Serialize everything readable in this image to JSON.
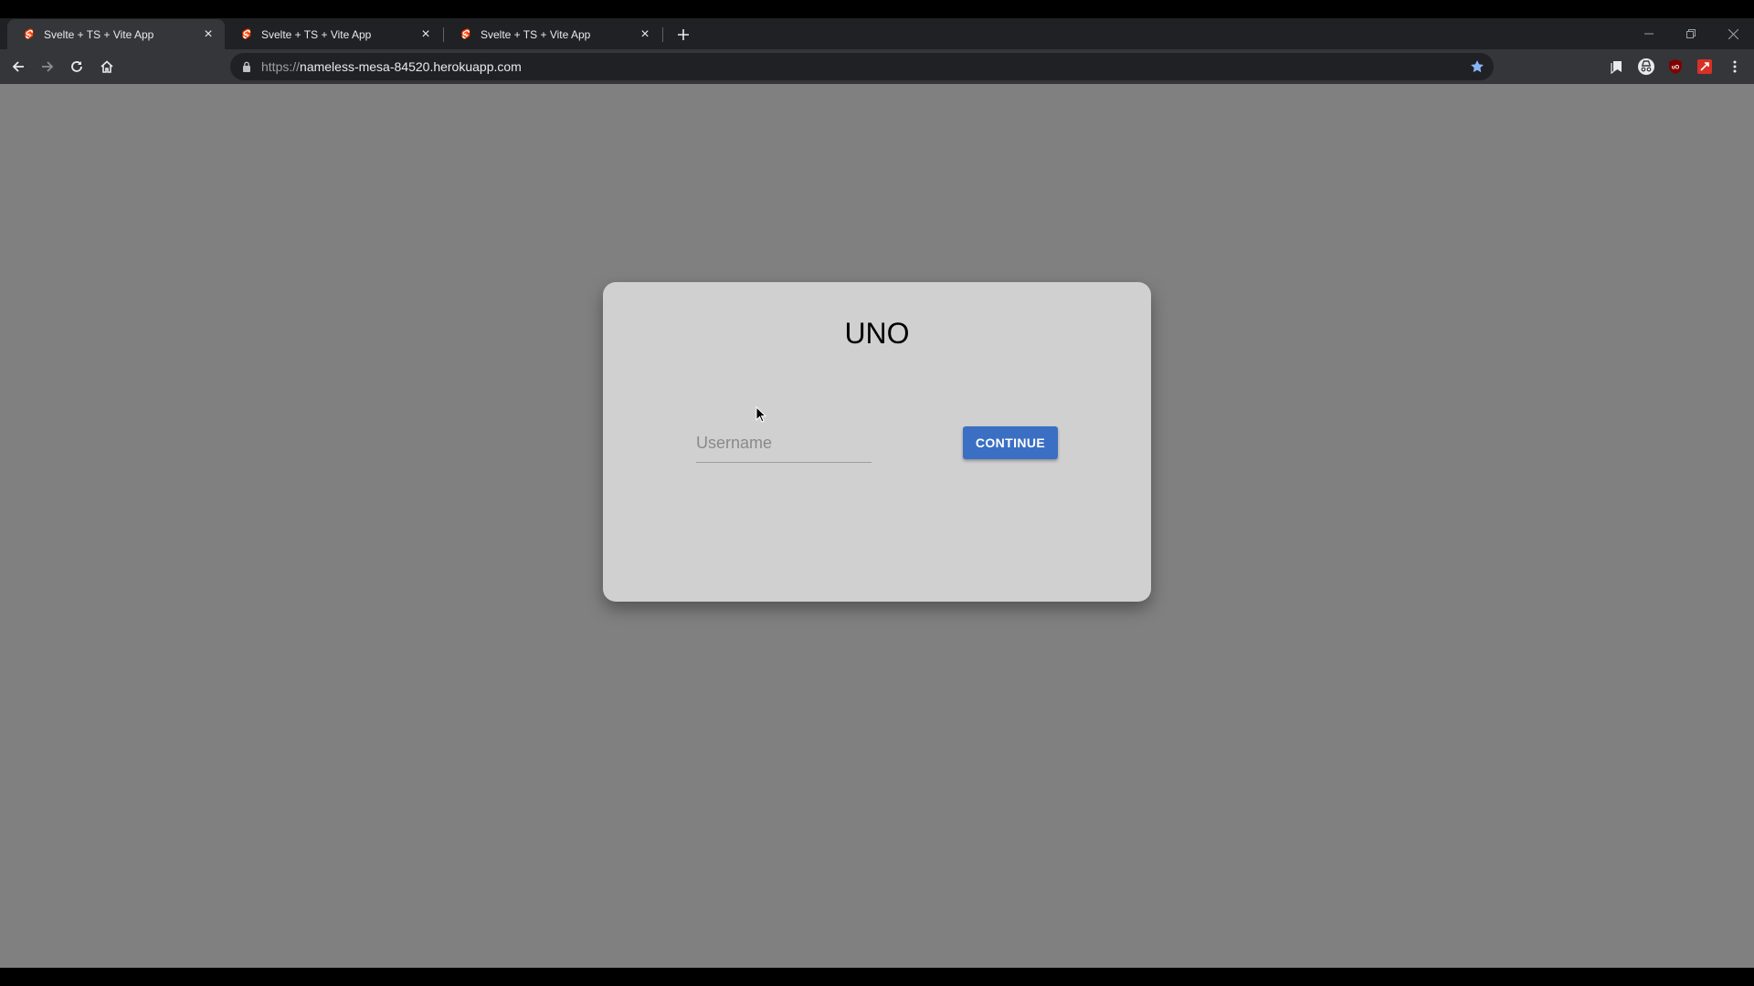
{
  "browser": {
    "tabs": [
      {
        "title": "Svelte + TS + Vite App",
        "active": true
      },
      {
        "title": "Svelte + TS + Vite App",
        "active": false
      },
      {
        "title": "Svelte + TS + Vite App",
        "active": false
      }
    ],
    "url_scheme": "https://",
    "url_host": "nameless-mesa-84520.herokuapp.com",
    "icons": {
      "favicon": "svelte-logo-icon",
      "new_tab": "plus-icon",
      "back": "arrow-left-icon",
      "forward": "arrow-right-icon",
      "reload": "reload-icon",
      "home": "home-icon",
      "lock": "lock-icon",
      "bookmark": "star-icon",
      "extensions": [
        "reading-list-icon",
        "incognito-profile-icon",
        "ublock-icon",
        "red-extension-icon",
        "kebab-menu-icon"
      ]
    },
    "colors": {
      "tab_strip": "#202124",
      "toolbar": "#35363a",
      "bookmark_star": "#8ab4f8"
    }
  },
  "page": {
    "title": "UNO",
    "username_placeholder": "Username",
    "username_value": "",
    "continue_label": "CONTINUE",
    "colors": {
      "background": "#808080",
      "card": "#d0d0d0",
      "button": "#3a6fc4"
    }
  }
}
